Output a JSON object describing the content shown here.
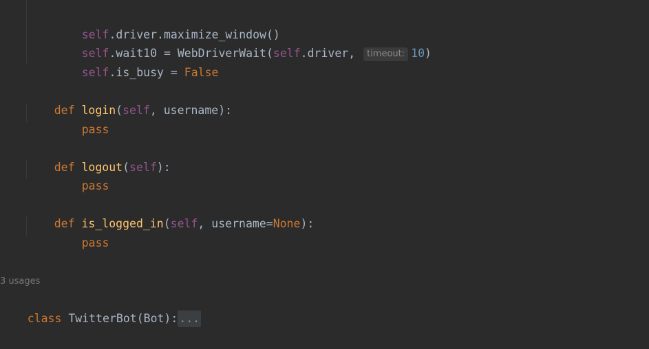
{
  "code": {
    "line1": {
      "self": "self",
      "rest": ".driver.maximize_window()"
    },
    "line2": {
      "self": "self",
      "attr": ".wait10 = WebDriverWait(",
      "self2": "self",
      "rest": ".driver,",
      "hint": "timeout:",
      "num": "10",
      "close": ")"
    },
    "line3": {
      "self": "self",
      "attr": ".is_busy = ",
      "value": "False"
    },
    "login": {
      "kw": "def",
      "name": "login",
      "open": "(",
      "self": "self",
      "params": ", username):"
    },
    "login_body": "pass",
    "logout": {
      "kw": "def",
      "name": "logout",
      "open": "(",
      "self": "self",
      "params": "):"
    },
    "logout_body": "pass",
    "is_logged_in": {
      "kw": "def",
      "name": "is_logged_in",
      "open": "(",
      "self": "self",
      "params1": ", username=",
      "default": "None",
      "params2": "):"
    },
    "is_logged_in_body": "pass",
    "usages": "3 usages",
    "class_line": {
      "kw": "class",
      "name": "TwitterBot(Bot):",
      "fold": "..."
    }
  }
}
